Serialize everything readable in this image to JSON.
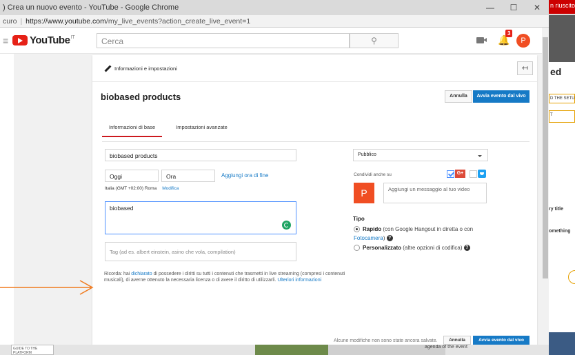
{
  "window": {
    "title": ") Crea un nuovo evento - YouTube - Google Chrome",
    "side_tab": "n riuscito"
  },
  "address": {
    "scheme": "curo",
    "url_host": "https://www.youtube.com",
    "url_path": "/my_live_events?action_create_live_event=1"
  },
  "header": {
    "logo_text": "YouTube",
    "country": "IT",
    "search_placeholder": "Cerca",
    "notifications": "3",
    "avatar_letter": "P"
  },
  "section": {
    "label": "Informazioni e impostazioni"
  },
  "event": {
    "title": "biobased products",
    "cancel_label": "Annulla",
    "go_live_label": "Avvia evento dal vivo"
  },
  "tabs": [
    {
      "label": "Informazioni di base"
    },
    {
      "label": "Impostazioni avanzate"
    }
  ],
  "form": {
    "title_value": "biobased products",
    "date_value": "Oggi",
    "time_value": "Ora",
    "add_end_time": "Aggiungi ora di fine",
    "timezone": "Italia (GMT +02:00) Roma",
    "modify": "Modifica",
    "description_value": "biobased",
    "tags_placeholder": "Tag (ad es. albert einstein, asino che vola, compilation)"
  },
  "notice": {
    "pre": "Ricorda: hai ",
    "link1": "dichiarato",
    "mid": " di possedere i diritti su tutti i contenuti che trasmetti in live streaming (compresi i contenuti musicali), di averne ottenuto la necessaria licenza o di avere il diritto di utilizzarli. ",
    "link2": "Ulteriori informazioni"
  },
  "privacy": {
    "selected": "Pubblico"
  },
  "share": {
    "label": "Condividi anche su",
    "gplus": "G+",
    "avatar_letter": "P",
    "message_placeholder": "Aggiungi un messaggio al tuo video"
  },
  "type": {
    "label": "Tipo",
    "rapid_bold": "Rapido",
    "rapid_text": " (con Google Hangout in diretta o con",
    "rapid_link": "Fotocamera",
    "rapid_close": ")",
    "custom_bold": "Personalizzato",
    "custom_text": " (altre opzioni di codifica)"
  },
  "footer": {
    "note": "Alcune modifiche non sono state ancora salvate.",
    "cancel_label": "Annulla",
    "go_live_label": "Avvia evento dal vivo"
  },
  "background": {
    "heading": "ed",
    "setup": "D THE SETUP",
    "t": "T",
    "title": "ry title",
    "something": "omething",
    "thumb": "GUIDE TO THE PLATFORM",
    "agenda": "agenda of the event"
  },
  "colors": {
    "accent": "#167ac6",
    "brand_red": "#e62117",
    "avatar": "#f04e23",
    "arrow": "#f07a1e"
  }
}
